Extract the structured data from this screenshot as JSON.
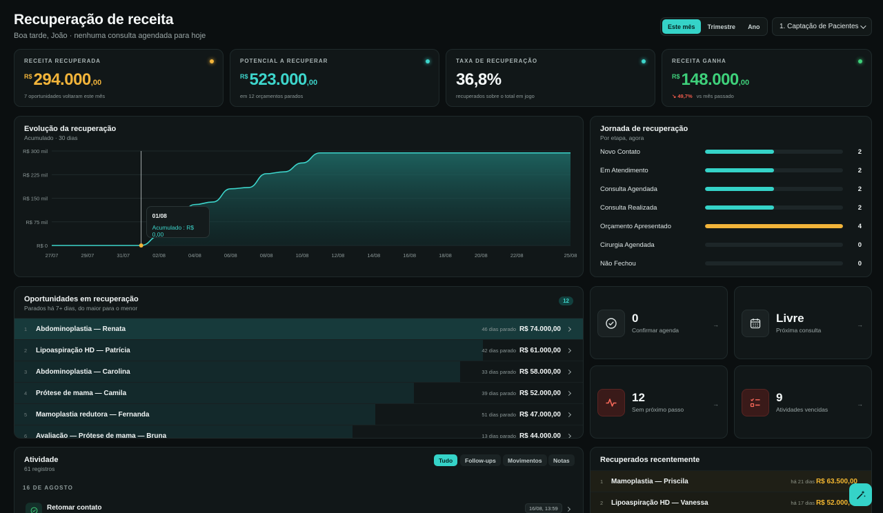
{
  "header": {
    "title": "Recuperação de receita",
    "subtitle": "Boa tarde, João · nenhuma consulta agendada para hoje",
    "period_tabs": [
      "Este mês",
      "Trimestre",
      "Ano"
    ],
    "active_period": "Este mês",
    "pipeline_select": "1. Captação de Pacientes"
  },
  "kpis": [
    {
      "label": "RECEITA RECUPERADA",
      "currency": "R$",
      "value": "294.000",
      "cents": ",00",
      "sub": "7 oportunidades voltaram este mês",
      "color": "#f2b43a",
      "dot": "#f2b43a"
    },
    {
      "label": "POTENCIAL A RECUPERAR",
      "currency": "R$",
      "value": "523.000",
      "cents": ",00",
      "sub": "em 12 orçamentos parados",
      "color": "#3dd5cb",
      "dot": "#3dd5cb"
    },
    {
      "label": "TAXA DE RECUPERAÇÃO",
      "currency": "",
      "value": "36,8%",
      "cents": "",
      "sub": "recuperados sobre o total em jogo",
      "color": "#f3f7f7",
      "dot": "#3dd5cb"
    },
    {
      "label": "RECEITA GANHA",
      "currency": "R$",
      "value": "148.000",
      "cents": ",00",
      "sub": "vs mês passado",
      "delta": "↘ 49,7%",
      "color": "#3ed07a",
      "dot": "#3ed07a"
    }
  ],
  "evolution": {
    "title": "Evolução da recuperação",
    "subtitle": "Acumulado · 30 dias",
    "tooltip_date": "01/08",
    "tooltip_text": "Acumulado : R$ 0,00"
  },
  "chart_data": {
    "type": "area",
    "title": "Evolução da recuperação",
    "xlabel": "",
    "ylabel": "",
    "ylim": [
      0,
      300000
    ],
    "yticks": [
      0,
      75000,
      150000,
      225000,
      300000
    ],
    "ytick_labels": [
      "R$ 0",
      "R$ 75 mil",
      "R$ 150 mil",
      "R$ 225 mil",
      "R$ 300 mil"
    ],
    "xtick_labels": [
      "27/07",
      "29/07",
      "31/07",
      "02/08",
      "04/08",
      "06/08",
      "08/08",
      "10/08",
      "12/08",
      "14/08",
      "16/08",
      "18/08",
      "20/08",
      "22/08",
      "25/08"
    ],
    "x": [
      "27/07",
      "28/07",
      "29/07",
      "30/07",
      "31/07",
      "01/08",
      "02/08",
      "03/08",
      "04/08",
      "05/08",
      "06/08",
      "07/08",
      "08/08",
      "09/08",
      "10/08",
      "11/08",
      "12/08",
      "13/08",
      "14/08",
      "15/08",
      "16/08",
      "17/08",
      "18/08",
      "19/08",
      "20/08",
      "21/08",
      "22/08",
      "23/08",
      "24/08",
      "25/08"
    ],
    "series": [
      {
        "values": [
          0,
          0,
          0,
          0,
          0,
          0,
          30000,
          90000,
          130000,
          138000,
          180000,
          184000,
          228000,
          234000,
          262000,
          294000,
          294000,
          294000,
          294000,
          294000,
          294000,
          294000,
          294000,
          294000,
          294000,
          294000,
          294000,
          294000,
          294000,
          294000
        ]
      }
    ],
    "highlight_index": 5,
    "grid": true,
    "colors": {
      "line": "#3dd5cb",
      "marker": "#f2b43a"
    }
  },
  "journey": {
    "title": "Jornada de recuperação",
    "subtitle": "Por etapa, agora",
    "max": 4,
    "stages": [
      {
        "label": "Novo Contato",
        "count": 2,
        "color": "#35d3c8"
      },
      {
        "label": "Em Atendimento",
        "count": 2,
        "color": "#35d3c8"
      },
      {
        "label": "Consulta Agendada",
        "count": 2,
        "color": "#35d3c8"
      },
      {
        "label": "Consulta Realizada",
        "count": 2,
        "color": "#35d3c8"
      },
      {
        "label": "Orçamento Apresentado",
        "count": 4,
        "color": "#f2b43a"
      },
      {
        "label": "Cirurgia Agendada",
        "count": 0,
        "color": "#35d3c8"
      },
      {
        "label": "Não Fechou",
        "count": 0,
        "color": "#35d3c8"
      }
    ]
  },
  "opportunities": {
    "title": "Oportunidades em recuperação",
    "subtitle": "Parados há 7+ dias, do maior para o menor",
    "count": "12",
    "max_value": 74000,
    "rows": [
      {
        "idx": "1",
        "name": "Abdominoplastia — Renata",
        "days": "46 dias parado",
        "value": "R$ 74.000,00",
        "amount": 74000
      },
      {
        "idx": "2",
        "name": "Lipoaspiração HD — Patrícia",
        "days": "42 dias parado",
        "value": "R$ 61.000,00",
        "amount": 61000
      },
      {
        "idx": "3",
        "name": "Abdominoplastia — Carolina",
        "days": "33 dias parado",
        "value": "R$ 58.000,00",
        "amount": 58000
      },
      {
        "idx": "4",
        "name": "Prótese de mama — Camila",
        "days": "39 dias parado",
        "value": "R$ 52.000,00",
        "amount": 52000
      },
      {
        "idx": "5",
        "name": "Mamoplastia redutora — Fernanda",
        "days": "51 dias parado",
        "value": "R$ 47.000,00",
        "amount": 47000
      },
      {
        "idx": "6",
        "name": "Avaliação — Prótese de mama — Bruna",
        "days": "13 dias parado",
        "value": "R$ 44.000,00",
        "amount": 44000
      }
    ]
  },
  "stats": [
    {
      "value": "0",
      "label": "Confirmar agenda",
      "icon": "check-circle-icon",
      "tone": "neutral"
    },
    {
      "value": "Livre",
      "label": "Próxima consulta",
      "icon": "calendar-icon",
      "tone": "neutral"
    },
    {
      "value": "12",
      "label": "Sem próximo passo",
      "icon": "pulse-icon",
      "tone": "alert"
    },
    {
      "value": "9",
      "label": "Atividades vencidas",
      "icon": "checklist-icon",
      "tone": "alert"
    }
  ],
  "activity": {
    "title": "Atividade",
    "subtitle": "61 registros",
    "filters": [
      "Tudo",
      "Follow-ups",
      "Movimentos",
      "Notas"
    ],
    "active_filter": "Tudo",
    "date_group": "16 DE AGOSTO",
    "items": [
      {
        "title": "Retomar contato",
        "time": "16/08, 13:59"
      }
    ]
  },
  "recent": {
    "title": "Recuperados recentemente",
    "rows": [
      {
        "idx": "1",
        "name": "Mamoplastia — Priscila",
        "days": "há 21 dias",
        "value": "R$ 63.500,00"
      },
      {
        "idx": "2",
        "name": "Lipoaspiração HD — Vanessa",
        "days": "há 17 dias",
        "value": "R$ 52.000,00"
      }
    ]
  }
}
